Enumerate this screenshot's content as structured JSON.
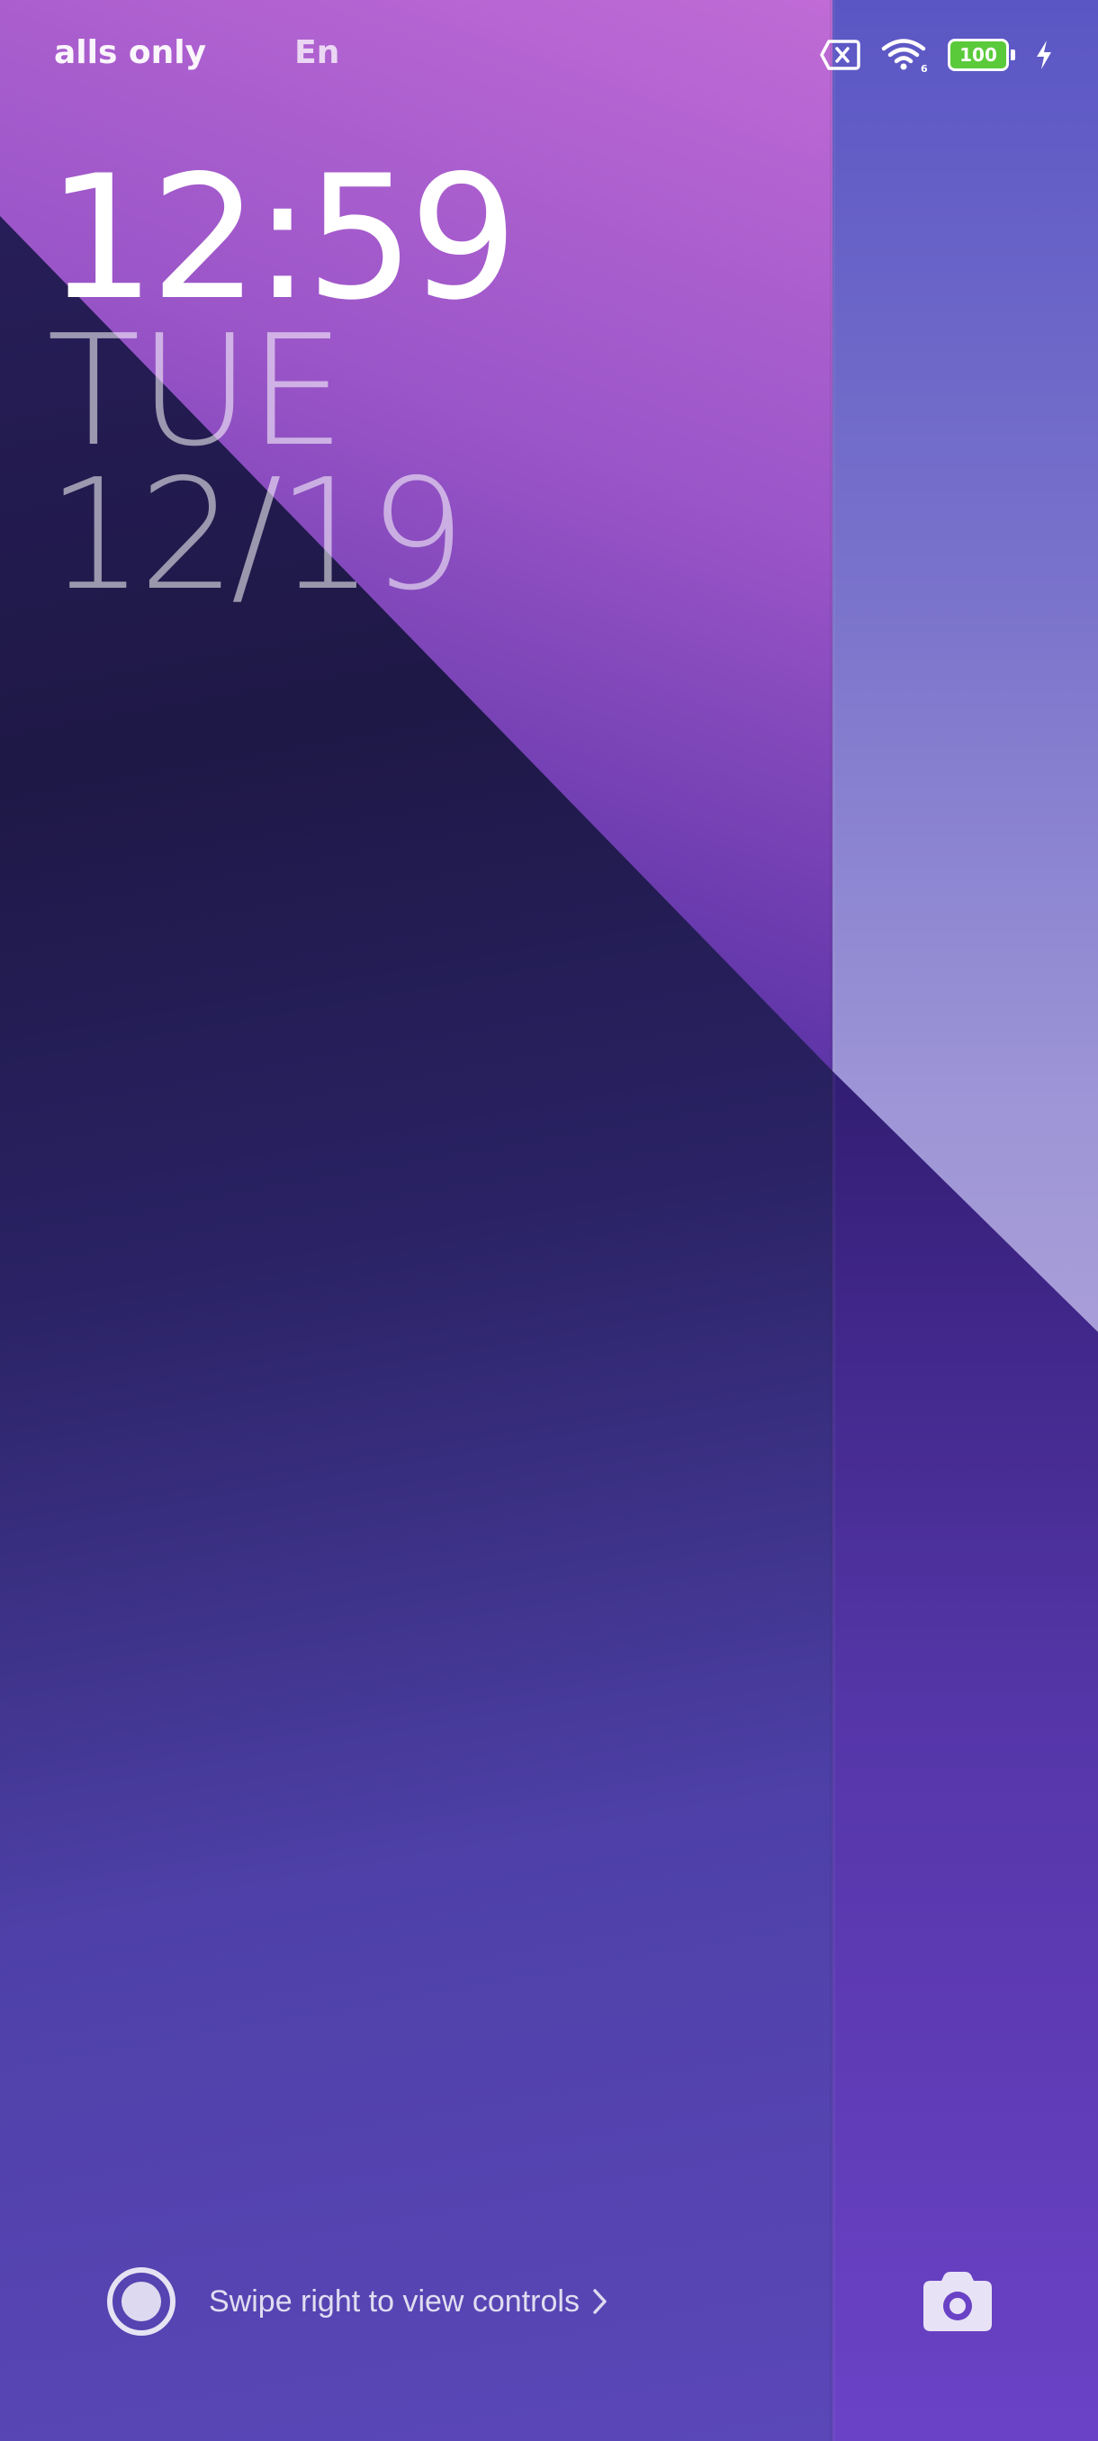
{
  "status_bar": {
    "ticker_1": "alls only",
    "ticker_2": "En",
    "battery_level": "100",
    "icons": [
      "no-sim-icon",
      "wifi-icon",
      "battery-icon",
      "charging-bolt-icon"
    ]
  },
  "clock": {
    "time": "12:59",
    "day": "TUE",
    "date": "12/19"
  },
  "bottom": {
    "hint_text": "Swipe right to view controls",
    "icons": [
      "controls-ring-icon",
      "chevron-right-icon",
      "camera-icon"
    ]
  },
  "colors": {
    "battery_fill": "#5aca3a",
    "accent_purple": "#6a42c6"
  }
}
